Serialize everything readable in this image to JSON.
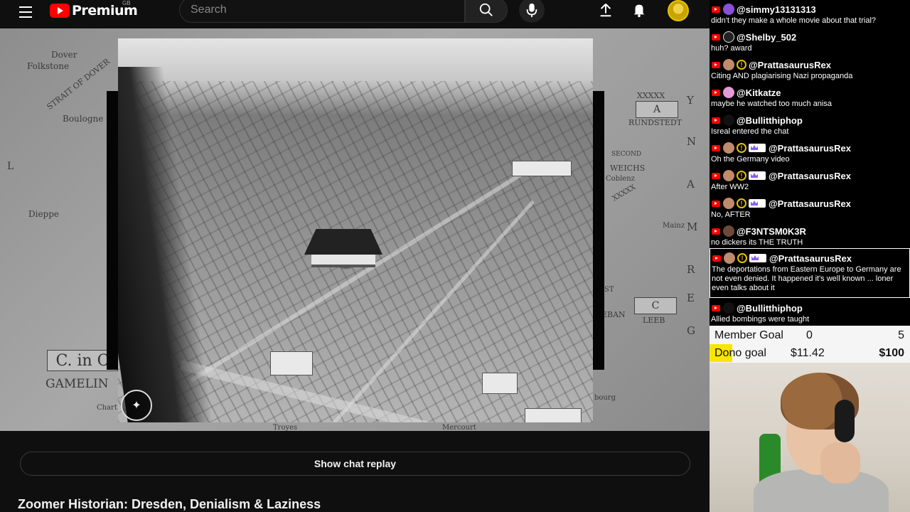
{
  "header": {
    "logo_text": "Premium",
    "logo_region": "GB",
    "search_placeholder": "Search"
  },
  "video": {
    "map_labels": {
      "dover": "Dover",
      "folkstone": "Folkstone",
      "strait": "STRAIT OF DOVER",
      "boulogne": "Boulogne",
      "dieppe": "Dieppe",
      "l": "L",
      "c_in": "C. in C",
      "gamelin": "GAMELIN",
      "chart": "Chart",
      "a_box": "A",
      "rundstedt": "RUNDSTEDT",
      "second": "SECOND",
      "weichs": "WEICHS",
      "coblenz": "Coblenz",
      "mainz": "Mainz",
      "c_box": "C",
      "leeb": "LEEB",
      "germany_g": "G",
      "germany_e": "E",
      "germany_r": "R",
      "germany_m": "M",
      "germany_a": "A",
      "germany_n": "N",
      "germany_y": "Y",
      "xxxxx1": "XXXXX",
      "xxxxx2": "XXXXX",
      "troyes": "Troyes",
      "bourg": "bourg",
      "eban": "EBAN",
      "st": "ST",
      "mercourt": "Mercourt"
    }
  },
  "show_chat_label": "Show chat replay",
  "video_title": "Zoomer Historian: Dresden, Denialism & Laziness",
  "chat": {
    "messages": [
      {
        "user": "@simmy13131313",
        "text": "didn't they make a whole movie about that trial?"
      },
      {
        "user": "@Shelby_502",
        "text": "huh? award"
      },
      {
        "user": "@PrattasaurusRex",
        "text": "Citing AND plagiarising Nazi propaganda"
      },
      {
        "user": "@Kitkatze",
        "text": "maybe he watched too much anisa"
      },
      {
        "user": "@Bullitthiphop",
        "text": "Isreal entered the chat"
      },
      {
        "user": "@PrattasaurusRex",
        "text": "Oh the Germany video"
      },
      {
        "user": "@PrattasaurusRex",
        "text": "After WW2"
      },
      {
        "user": "@PrattasaurusRex",
        "text": "No, AFTER"
      },
      {
        "user": "@F3NTSM0K3R",
        "text": "no dickers its THE TRUTH"
      },
      {
        "user": "@PrattasaurusRex",
        "text": "The deportations from Eastern Europe to Germany are not even denied. It happened it's well known ... loner even talks about it"
      },
      {
        "user": "@Bullitthiphop",
        "text": "Allied bombings were taught"
      }
    ]
  },
  "goals": {
    "member_label": "Member Goal",
    "member_current": "0",
    "member_target": "5",
    "dono_label": "Dono goal",
    "dono_current": "$11.42",
    "dono_target": "$100",
    "dono_progress": 0.1142
  },
  "icons": {
    "menu": "menu-icon",
    "search": "search-icon",
    "mic": "mic-icon",
    "upload": "upload-icon",
    "bell": "bell-icon"
  },
  "colors": {
    "brand_red": "#ff0000",
    "background": "#0f0f0f",
    "goal_yellow": "#f7e600"
  }
}
